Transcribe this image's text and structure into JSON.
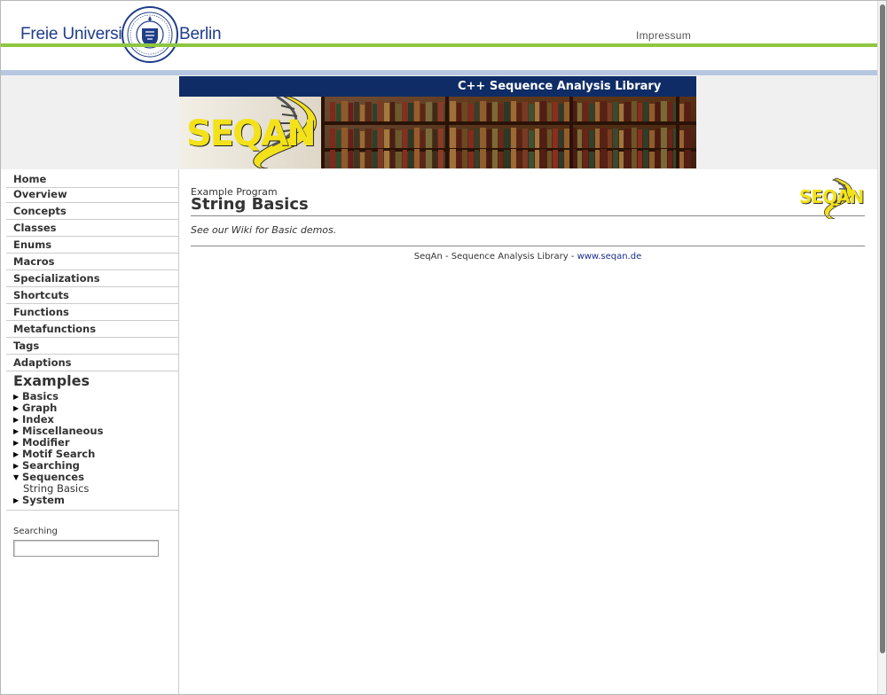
{
  "header": {
    "university_name_left": "Freie Universität",
    "university_name_right": "Berlin",
    "impressum_label": "Impressum"
  },
  "banner": {
    "title": "C++ Sequence Analysis Library",
    "logo_text": "SEQAN"
  },
  "sidebar": {
    "nav_items": [
      {
        "label": "Home"
      },
      {
        "label": "Overview"
      },
      {
        "label": "Concepts"
      },
      {
        "label": "Classes"
      },
      {
        "label": "Enums"
      },
      {
        "label": "Macros"
      },
      {
        "label": "Specializations"
      },
      {
        "label": "Shortcuts"
      },
      {
        "label": "Functions"
      },
      {
        "label": "Metafunctions"
      },
      {
        "label": "Tags"
      },
      {
        "label": "Adaptions"
      }
    ],
    "examples_heading": "Examples",
    "examples": [
      {
        "label": "Basics",
        "expanded": false
      },
      {
        "label": "Graph",
        "expanded": false
      },
      {
        "label": "Index",
        "expanded": false
      },
      {
        "label": "Miscellaneous",
        "expanded": false
      },
      {
        "label": "Modifier",
        "expanded": false
      },
      {
        "label": "Motif Search",
        "expanded": false
      },
      {
        "label": "Searching",
        "expanded": false
      },
      {
        "label": "Sequences",
        "expanded": true,
        "children": [
          {
            "label": "String Basics"
          }
        ]
      },
      {
        "label": "System",
        "expanded": false
      }
    ],
    "search": {
      "label": "Searching",
      "value": "",
      "placeholder": ""
    }
  },
  "main": {
    "kicker": "Example Program",
    "title": "String Basics",
    "logo_text": "SEQAN",
    "description_prefix": "See our ",
    "description_link": "Wiki",
    "description_suffix": " for Basic demos.",
    "footer_text": "SeqAn - Sequence Analysis Library - ",
    "footer_link": "www.seqan.de"
  },
  "colors": {
    "fu_blue": "#1f3d8a",
    "fu_green": "#8dc63f",
    "banner_navy": "#0f2c66",
    "seqan_yellow": "#f3e21a",
    "link_blue": "#1b2f8a"
  }
}
